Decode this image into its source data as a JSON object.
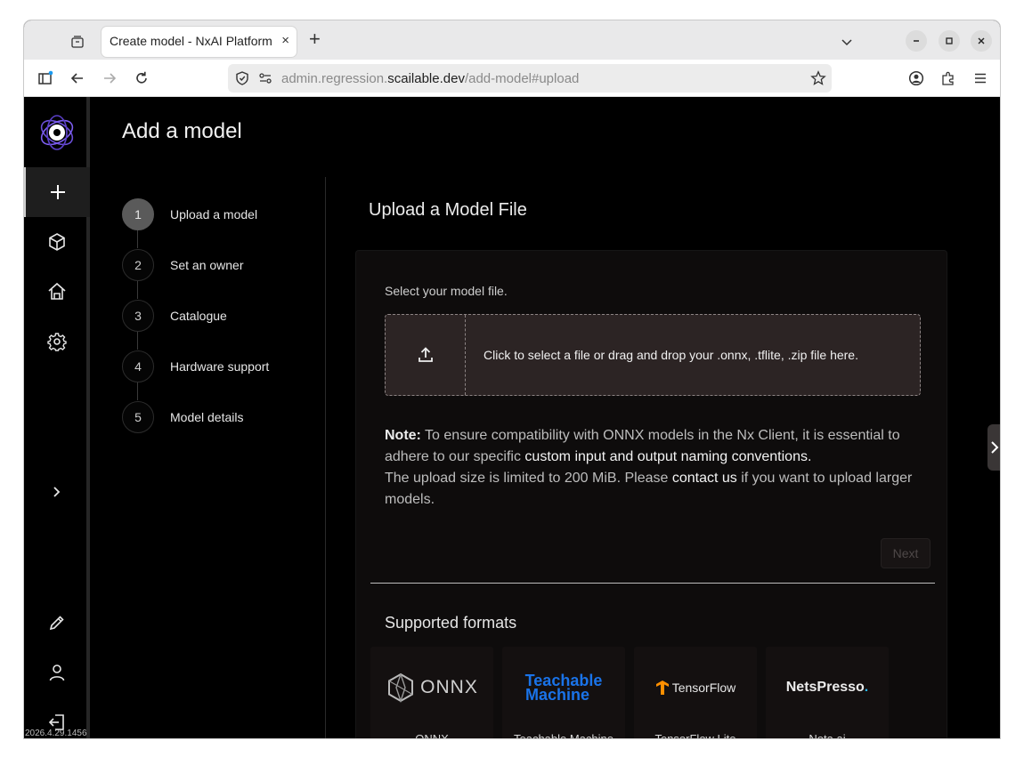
{
  "browser": {
    "tab_title": "Create model - NxAI Platform",
    "tab_close": "×",
    "new_tab": "+",
    "url_prefix": "admin.regression.",
    "url_host": "scailable.dev",
    "url_path": "/add-model#upload"
  },
  "rail": {
    "version": "2026.4.29.1456",
    "items": [
      "add-model",
      "models",
      "home",
      "settings"
    ]
  },
  "page": {
    "title": "Add a model",
    "steps": [
      {
        "num": "1",
        "label": "Upload a model",
        "current": true
      },
      {
        "num": "2",
        "label": "Set an owner",
        "current": false
      },
      {
        "num": "3",
        "label": "Catalogue",
        "current": false
      },
      {
        "num": "4",
        "label": "Hardware support",
        "current": false
      },
      {
        "num": "5",
        "label": "Model details",
        "current": false
      }
    ]
  },
  "upload": {
    "section_title": "Upload a Model File",
    "select_label": "Select your model file.",
    "drop_text": "Click to select a file or drag and drop your .onnx, .tflite, .zip file here.",
    "note_bold": "Note:",
    "note_text_1": " To ensure compatibility with ONNX models in the Nx Client, it is essential to adhere to our specific ",
    "note_link_1": "custom input and output naming conventions.",
    "note_text_2": "The upload size is limited to 200 MiB. Please ",
    "note_link_2": "contact us",
    "note_text_3": " if you want to upload larger models.",
    "next_label": "Next"
  },
  "formats": {
    "title": "Supported formats",
    "items": [
      {
        "logo": "ONNX",
        "name": "ONNX"
      },
      {
        "logo_l1": "Teachable",
        "logo_l2": "Machine",
        "name": "Teachable Machine"
      },
      {
        "logo": "TensorFlow",
        "name": "TensorFlow Lite"
      },
      {
        "logo": "NetsPresso",
        "name": "Nota.ai"
      }
    ]
  },
  "colors": {
    "accent_purple": "#6b4fd8",
    "teachable_blue": "#1a73e8",
    "tensorflow_orange": "#ff8f00",
    "netspresso_blue": "#29b6f6"
  }
}
